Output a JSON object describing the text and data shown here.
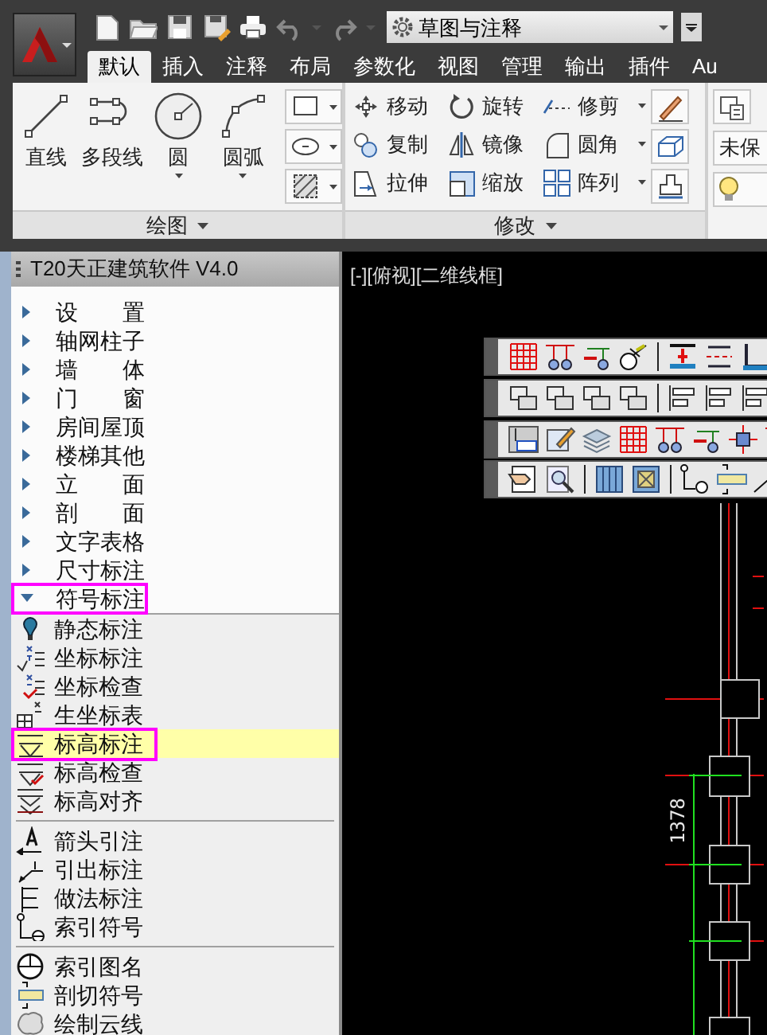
{
  "quick_access": {
    "workspace": "草图与注释"
  },
  "ribbon_tabs": [
    {
      "label": "默认",
      "selected": true
    },
    {
      "label": "插入",
      "selected": false
    },
    {
      "label": "注释",
      "selected": false
    },
    {
      "label": "布局",
      "selected": false
    },
    {
      "label": "参数化",
      "selected": false
    },
    {
      "label": "视图",
      "selected": false
    },
    {
      "label": "管理",
      "selected": false
    },
    {
      "label": "输出",
      "selected": false
    },
    {
      "label": "插件",
      "selected": false
    },
    {
      "label": "Au",
      "selected": false
    }
  ],
  "ribbon": {
    "draw_panel": {
      "title": "绘图",
      "tools": [
        {
          "label": "直线",
          "dropdown": false
        },
        {
          "label": "多段线",
          "dropdown": false
        },
        {
          "label": "圆",
          "dropdown": true
        },
        {
          "label": "圆弧",
          "dropdown": true
        }
      ]
    },
    "modify_panel": {
      "title": "修改",
      "tools": [
        {
          "label": "移动",
          "dropdown": false
        },
        {
          "label": "旋转",
          "dropdown": false
        },
        {
          "label": "修剪",
          "dropdown": true
        },
        {
          "label": "复制",
          "dropdown": false
        },
        {
          "label": "镜像",
          "dropdown": false
        },
        {
          "label": "圆角",
          "dropdown": true
        },
        {
          "label": "拉伸",
          "dropdown": false
        },
        {
          "label": "缩放",
          "dropdown": false
        },
        {
          "label": "阵列",
          "dropdown": true
        }
      ]
    },
    "layer_panel": {
      "field": "未保"
    }
  },
  "palette": {
    "title": "T20天正建筑软件 V4.0",
    "items": [
      {
        "label": "设　　置",
        "expanded": false,
        "highlighted": false
      },
      {
        "label": "轴网柱子",
        "expanded": false,
        "highlighted": false
      },
      {
        "label": "墙　　体",
        "expanded": false,
        "highlighted": false
      },
      {
        "label": "门　　窗",
        "expanded": false,
        "highlighted": false
      },
      {
        "label": "房间屋顶",
        "expanded": false,
        "highlighted": false
      },
      {
        "label": "楼梯其他",
        "expanded": false,
        "highlighted": false
      },
      {
        "label": "立　　面",
        "expanded": false,
        "highlighted": false
      },
      {
        "label": "剖　　面",
        "expanded": false,
        "highlighted": false
      },
      {
        "label": "文字表格",
        "expanded": false,
        "highlighted": false
      },
      {
        "label": "尺寸标注",
        "expanded": false,
        "highlighted": false
      },
      {
        "label": "符号标注",
        "expanded": true,
        "highlighted": true,
        "children": [
          {
            "label": "静态标注",
            "selected": false,
            "highlighted": false,
            "separator_before": false
          },
          {
            "label": "坐标标注",
            "selected": false,
            "highlighted": false,
            "separator_before": false
          },
          {
            "label": "坐标检查",
            "selected": false,
            "highlighted": false,
            "separator_before": false
          },
          {
            "label": "生坐标表",
            "selected": false,
            "highlighted": false,
            "separator_before": false
          },
          {
            "label": "标高标注",
            "selected": true,
            "highlighted": true,
            "separator_before": false
          },
          {
            "label": "标高检查",
            "selected": false,
            "highlighted": false,
            "separator_before": false
          },
          {
            "label": "标高对齐",
            "selected": false,
            "highlighted": false,
            "separator_before": false
          },
          {
            "label": "箭头引注",
            "selected": false,
            "highlighted": false,
            "separator_before": true
          },
          {
            "label": "引出标注",
            "selected": false,
            "highlighted": false,
            "separator_before": false
          },
          {
            "label": "做法标注",
            "selected": false,
            "highlighted": false,
            "separator_before": false
          },
          {
            "label": "索引符号",
            "selected": false,
            "highlighted": false,
            "separator_before": false
          },
          {
            "label": "索引图名",
            "selected": false,
            "highlighted": false,
            "separator_before": true
          },
          {
            "label": "剖切符号",
            "selected": false,
            "highlighted": false,
            "separator_before": false
          },
          {
            "label": "绘制云线",
            "selected": false,
            "highlighted": false,
            "separator_before": false
          }
        ]
      }
    ]
  },
  "viewport": {
    "label": "[-][俯视][二维线框]",
    "dimension": "1378"
  }
}
